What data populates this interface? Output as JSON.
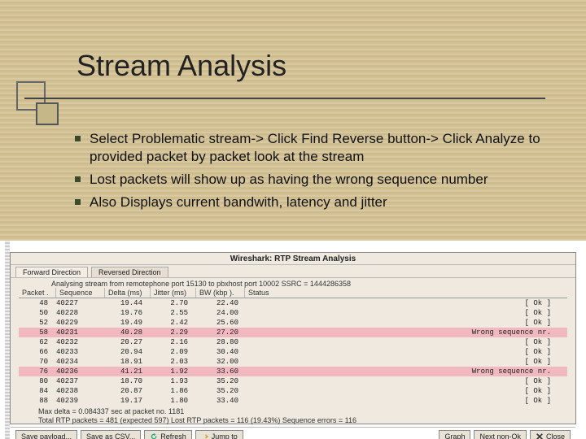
{
  "slide": {
    "title": "Stream Analysis",
    "bullet1": "Select Problematic stream-> Click Find Reverse button-> Click Analyze to provided packet by packet look at the stream",
    "bullet2": "Lost packets will show up as having the wrong sequence number",
    "bullet3": "Also Displays current bandwith, latency and jitter"
  },
  "ws": {
    "title": "Wireshark: RTP Stream Analysis",
    "tab_forward": "Forward Direction",
    "tab_reversed": "Reversed Direction",
    "info": "Analysing stream from  remotephone port 15130  to  pbxhost port 10002   SSRC = 1444286358",
    "head": {
      "packet": "Packet .",
      "sequence": "Sequence",
      "delta": "Delta (ms)",
      "jitter": "Jitter (ms)",
      "bw": "BW (kbp ).",
      "status": "Status"
    },
    "rows": [
      {
        "packet": "48",
        "sequence": "40227",
        "delta": "19.44",
        "jitter": "2.70",
        "bw": "22.40",
        "status": "[ Ok ]",
        "bad": false
      },
      {
        "packet": "50",
        "sequence": "40228",
        "delta": "19.76",
        "jitter": "2.55",
        "bw": "24.00",
        "status": "[ Ok ]",
        "bad": false
      },
      {
        "packet": "52",
        "sequence": "40229",
        "delta": "19.49",
        "jitter": "2.42",
        "bw": "25.60",
        "status": "[ Ok ]",
        "bad": false
      },
      {
        "packet": "58",
        "sequence": "40231",
        "delta": "40.28",
        "jitter": "2.29",
        "bw": "27.20",
        "status": "Wrong sequence nr.",
        "bad": true
      },
      {
        "packet": "62",
        "sequence": "40232",
        "delta": "20.27",
        "jitter": "2.16",
        "bw": "28.80",
        "status": "[ Ok ]",
        "bad": false
      },
      {
        "packet": "66",
        "sequence": "40233",
        "delta": "20.94",
        "jitter": "2.09",
        "bw": "30.40",
        "status": "[ Ok ]",
        "bad": false
      },
      {
        "packet": "70",
        "sequence": "40234",
        "delta": "18.91",
        "jitter": "2.03",
        "bw": "32.00",
        "status": "[ Ok ]",
        "bad": false
      },
      {
        "packet": "76",
        "sequence": "40236",
        "delta": "41.21",
        "jitter": "1.92",
        "bw": "33.60",
        "status": "Wrong sequence nr.",
        "bad": true
      },
      {
        "packet": "80",
        "sequence": "40237",
        "delta": "18.70",
        "jitter": "1.93",
        "bw": "35.20",
        "status": "[ Ok ]",
        "bad": false
      },
      {
        "packet": "84",
        "sequence": "40238",
        "delta": "20.87",
        "jitter": "1.86",
        "bw": "35.20",
        "status": "[ Ok ]",
        "bad": false
      },
      {
        "packet": "88",
        "sequence": "40239",
        "delta": "19.17",
        "jitter": "1.80",
        "bw": "33.40",
        "status": "[ Ok ]",
        "bad": false
      }
    ],
    "summary1": "Max delta = 0.084337 sec at packet no. 1181",
    "summary2": "Total RTP packets = 481   (expected 597)    Lost RTP packets = 116 (19.43%)   Sequence errors = 116",
    "btn_save_payload": "Save payload...",
    "btn_save_csv": "Save as CSV...",
    "btn_refresh": "Refresh",
    "btn_jump": "Jump to",
    "btn_graph": "Graph",
    "btn_next": "Next non-Ok",
    "btn_close": "Close"
  }
}
